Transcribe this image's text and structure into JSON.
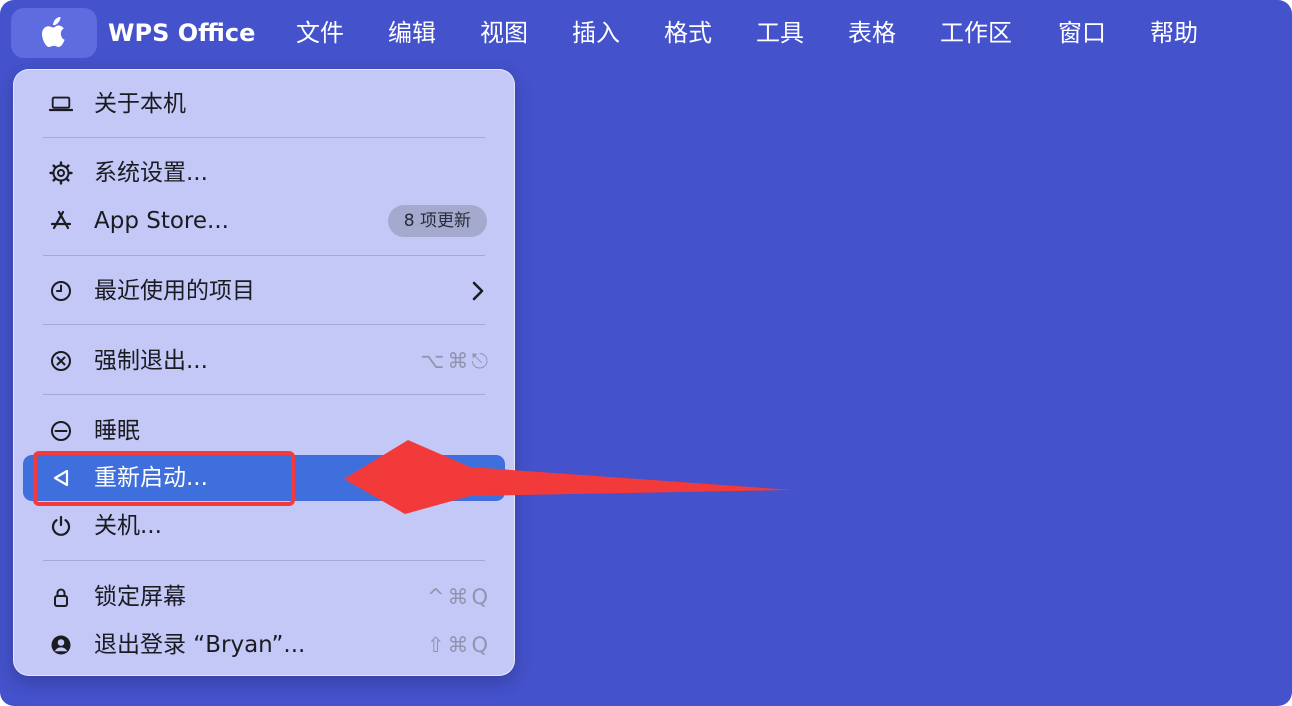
{
  "menubar": {
    "app_name": "WPS Office",
    "menus": [
      "文件",
      "编辑",
      "视图",
      "插入",
      "格式",
      "工具",
      "表格",
      "工作区",
      "窗口",
      "帮助"
    ]
  },
  "apple_menu": {
    "items": [
      {
        "label": "关于本机",
        "icon": "laptop-icon"
      },
      {
        "label": "系统设置...",
        "icon": "gear-icon"
      },
      {
        "label": "App Store...",
        "icon": "app-store-icon",
        "badge": "8 项更新"
      },
      {
        "label": "最近使用的项目",
        "icon": "clock-icon",
        "submenu": true
      },
      {
        "label": "强制退出...",
        "icon": "force-quit-icon",
        "shortcut": "⌥⌘⎋"
      },
      {
        "label": "睡眠",
        "icon": "sleep-icon"
      },
      {
        "label": "重新启动...",
        "icon": "restart-icon",
        "highlighted": true
      },
      {
        "label": "关机...",
        "icon": "power-icon"
      },
      {
        "label": "锁定屏幕",
        "icon": "lock-icon",
        "shortcut": "^⌘Q"
      },
      {
        "label": "退出登录 “Bryan”...",
        "icon": "user-icon",
        "shortcut": "⇧⌘Q"
      }
    ]
  },
  "colors": {
    "desktop": "#4452cc",
    "menu_background": "#c3c8f6",
    "highlight": "#3f6fdc",
    "annotation": "#f33a3a"
  }
}
